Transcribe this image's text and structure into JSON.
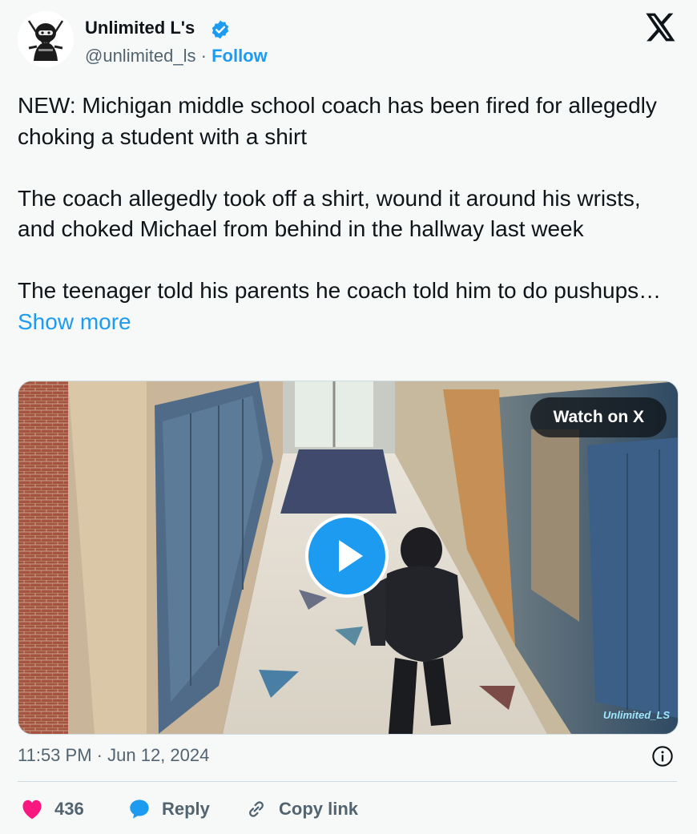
{
  "author": {
    "name": "Unlimited L's",
    "handle": "@unlimited_ls",
    "separator": "·",
    "follow_label": "Follow",
    "verified": true,
    "avatar_icon": "ninja-avatar"
  },
  "brand": {
    "logo_icon": "x-logo-icon"
  },
  "tweet": {
    "paragraphs": [
      "NEW: Michigan middle school coach has been fired for allegedly choking a student with a shirt",
      "The coach allegedly took off a shirt, wound it around his wrists, and choked Michael from behind in the hallway last week",
      "The teenager told his parents he coach told him to do pushups…"
    ],
    "show_more_label": "Show more"
  },
  "media": {
    "watch_label": "Watch on X",
    "watermark": "Unlimited_LS",
    "play_icon": "play-icon"
  },
  "meta": {
    "time": "11:53 PM",
    "separator": "·",
    "date": "Jun 12, 2024",
    "info_icon": "info-icon"
  },
  "actions": {
    "like_count": "436",
    "reply_label": "Reply",
    "copy_label": "Copy link"
  },
  "colors": {
    "accent": "#1d9bf0",
    "like": "#f91880",
    "text": "#0f1419",
    "muted": "#536471",
    "background": "#f7f9f9"
  }
}
